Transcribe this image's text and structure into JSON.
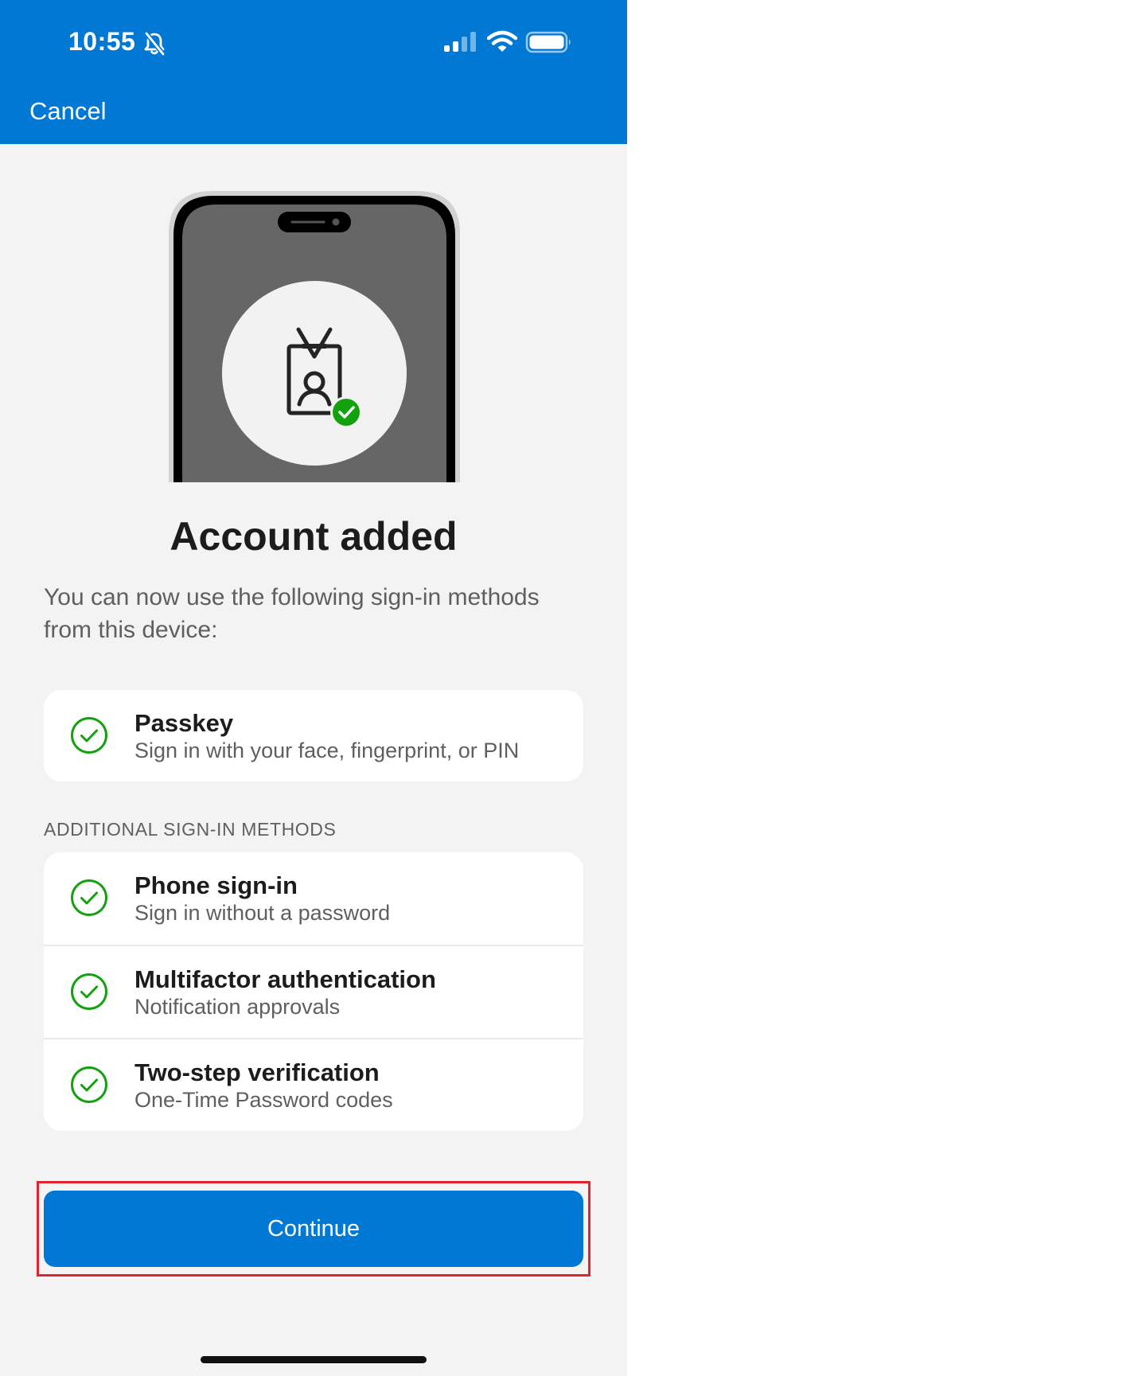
{
  "status_bar": {
    "time": "10:55",
    "icons": [
      "bell-slash-icon",
      "cellular-signal-icon",
      "wifi-icon",
      "battery-icon"
    ]
  },
  "header": {
    "cancel_label": "Cancel",
    "background_color": "#0078d4"
  },
  "illustration": {
    "icons": [
      "phone-icon",
      "badge-icon",
      "success-check-icon"
    ],
    "check_color": "#13a10e"
  },
  "main": {
    "title": "Account added",
    "subtitle": "You can now use the following sign-in methods from this device:"
  },
  "primary_method": {
    "title": "Passkey",
    "description": "Sign in with your face, fingerprint, or PIN"
  },
  "additional_methods": {
    "header": "ADDITIONAL SIGN-IN METHODS",
    "items": [
      {
        "title": "Phone sign-in",
        "description": "Sign in without a password"
      },
      {
        "title": "Multifactor authentication",
        "description": "Notification approvals"
      },
      {
        "title": "Two-step verification",
        "description": "One-Time Password codes"
      }
    ]
  },
  "continue_label": "Continue",
  "colors": {
    "accent": "#0078d4",
    "success": "#13a10e",
    "highlight": "#e0242f"
  }
}
